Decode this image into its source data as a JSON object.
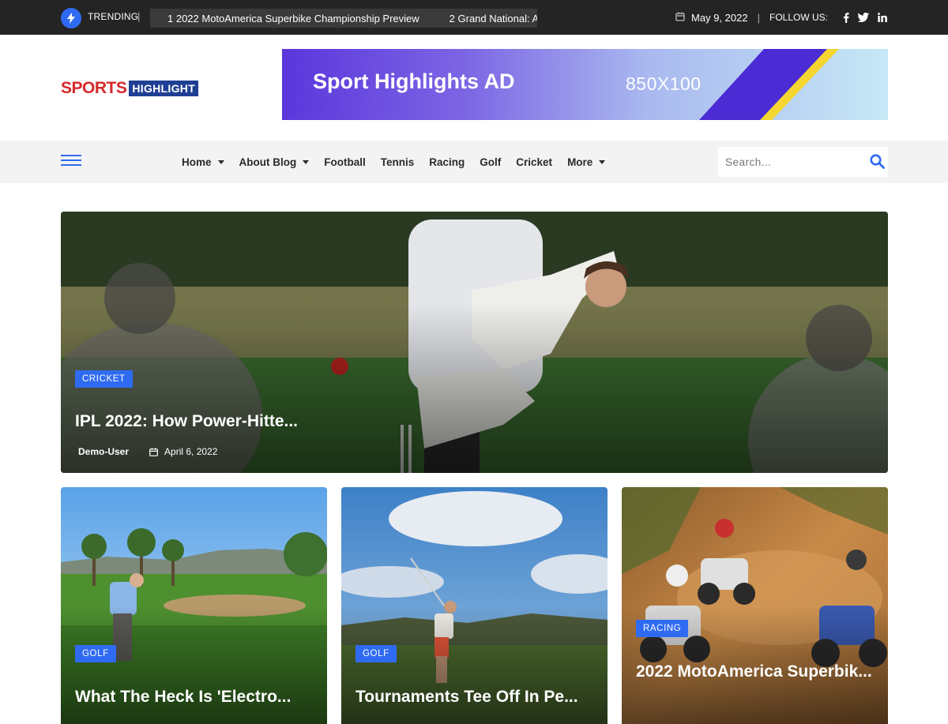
{
  "topbar": {
    "trending_label": "TRENDING",
    "trending_icon": "bolt-icon",
    "ticker": [
      "1 2022 MotoAmerica Superbike Championship Preview",
      "2 Grand National: A"
    ],
    "date": "May 9, 2022",
    "follow_label": "FOLLOW US:",
    "social": [
      "facebook-icon",
      "twitter-icon",
      "linkedin-icon"
    ]
  },
  "header": {
    "logo_part1": "SPORTS",
    "logo_part2": "HIGHLIGHT",
    "ad_title": "Sport Highlights AD",
    "ad_size": "850X100"
  },
  "nav": {
    "items": [
      {
        "label": "Home",
        "dropdown": true
      },
      {
        "label": "About Blog",
        "dropdown": true
      },
      {
        "label": "Football",
        "dropdown": false
      },
      {
        "label": "Tennis",
        "dropdown": false
      },
      {
        "label": "Racing",
        "dropdown": false
      },
      {
        "label": "Golf",
        "dropdown": false
      },
      {
        "label": "Cricket",
        "dropdown": false
      },
      {
        "label": "More",
        "dropdown": true
      }
    ],
    "search_placeholder": "Search..."
  },
  "hero": {
    "category": "CRICKET",
    "title": "IPL 2022: How Power-Hitte...",
    "author": "Demo-User",
    "date": "April 6, 2022"
  },
  "cards": [
    {
      "category": "GOLF",
      "title": "What The Heck Is 'Electro..."
    },
    {
      "category": "GOLF",
      "title": "Tournaments Tee Off In Pe..."
    },
    {
      "category": "RACING",
      "title": "2022 MotoAmerica Superbik..."
    }
  ],
  "colors": {
    "accent": "#2f6bf2",
    "topbar_bg": "#242424",
    "logo_red": "#d62a2a",
    "logo_blue": "#1f3f94",
    "nav_bg": "#f3f3f3"
  }
}
